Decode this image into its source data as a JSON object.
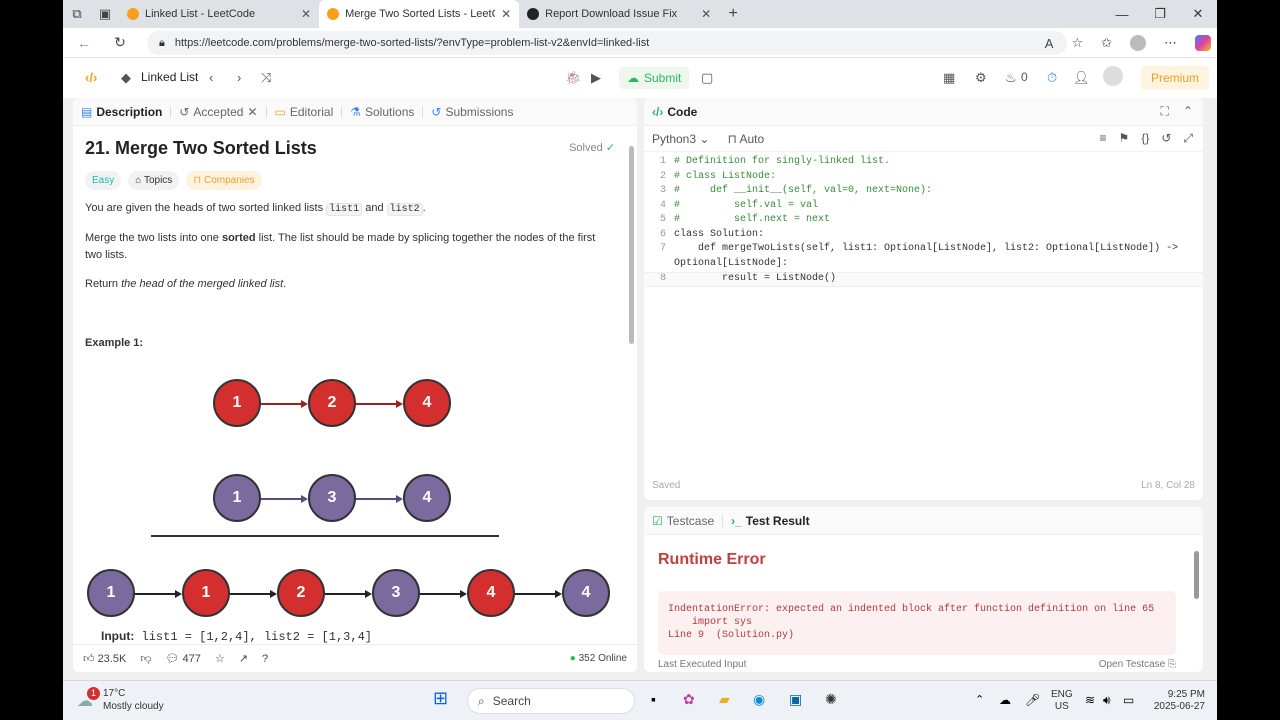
{
  "browser": {
    "tabs": [
      {
        "title": "Linked List - LeetCode",
        "active": false
      },
      {
        "title": "Merge Two Sorted Lists - LeetCod",
        "active": true
      },
      {
        "title": "Report Download Issue Fix",
        "active": false
      }
    ],
    "url": "https://leetcode.com/problems/merge-two-sorted-lists/?envType=problem-list-v2&envId=linked-list"
  },
  "header": {
    "problem_list": "Linked List",
    "submit_label": "Submit",
    "streak_count": "0",
    "premium_label": "Premium"
  },
  "left_tabs": {
    "description": "Description",
    "accepted": "Accepted",
    "editorial": "Editorial",
    "solutions": "Solutions",
    "submissions": "Submissions"
  },
  "problem": {
    "title": "21. Merge Two Sorted Lists",
    "status": "Solved",
    "difficulty": "Easy",
    "topics_label": "Topics",
    "companies_label": "Companies",
    "p1_prefix": "You are given the heads of two sorted linked lists",
    "p1_code1": "list1",
    "p1_and": "and",
    "p1_code2": "list2",
    "p1_end": ".",
    "p2_prefix": "Merge the two lists into one",
    "p2_bold": "sorted",
    "p2_suffix": "list. The list should be made by splicing together the nodes of the first two lists.",
    "p3_prefix": "Return",
    "p3_italic": "the head of the merged linked list",
    "p3_end": ".",
    "example_label": "Example 1:",
    "list1_nodes": [
      "1",
      "2",
      "4"
    ],
    "list2_nodes": [
      "1",
      "3",
      "4"
    ],
    "merged_nodes": [
      "1",
      "1",
      "2",
      "3",
      "4",
      "4"
    ],
    "input_label": "Input:",
    "input_value": "list1 = [1,2,4], list2 = [1,3,4]"
  },
  "footer_left": {
    "likes": "23.5K",
    "comments": "477",
    "online": "352 Online"
  },
  "code_panel": {
    "title": "Code",
    "language": "Python3",
    "auto": "Auto",
    "lines": [
      {
        "n": "1",
        "text": "# Definition for singly-linked list."
      },
      {
        "n": "2",
        "text": "# class ListNode:"
      },
      {
        "n": "3",
        "text": "#     def __init__(self, val=0, next=None):"
      },
      {
        "n": "4",
        "text": "#         self.val = val"
      },
      {
        "n": "5",
        "text": "#         self.next = next"
      },
      {
        "n": "6",
        "text": "class Solution:"
      },
      {
        "n": "7",
        "text": "    def mergeTwoLists(self, list1: Optional[ListNode], list2: Optional[ListNode]) ->"
      },
      {
        "n": "",
        "text": "Optional[ListNode]:"
      },
      {
        "n": "8",
        "text": "        result = ListNode()"
      }
    ],
    "saved": "Saved",
    "cursor_pos": "Ln 8, Col 28"
  },
  "result_panel": {
    "testcase_tab": "Testcase",
    "result_tab": "Test Result",
    "error_title": "Runtime Error",
    "error_text": "IndentationError: expected an indented block after function definition on line 65\n    import sys\nLine 9  (Solution.py)",
    "last_input": "Last Executed Input",
    "open_testcase": "Open Testcase"
  },
  "taskbar": {
    "temp": "17°C",
    "weather": "Mostly cloudy",
    "search": "Search",
    "lang1": "ENG",
    "lang2": "US",
    "time": "9:25 PM",
    "date": "2025-06-27",
    "notif": "1"
  },
  "colors": {
    "accent_green": "#2db55d",
    "node_red": "#d32f2f",
    "node_purple": "#7b6a9e",
    "error_red": "#b03a3a"
  }
}
